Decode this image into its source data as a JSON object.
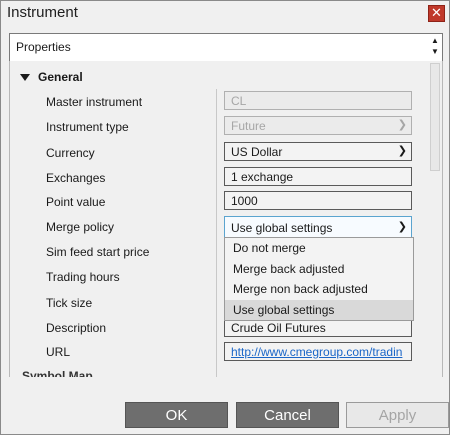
{
  "window": {
    "title": "Instrument",
    "close_glyph": "✕"
  },
  "header": {
    "label": "Properties"
  },
  "section": {
    "label": "General",
    "next_label": "Symbol Map"
  },
  "rows": [
    {
      "label": "Master instrument",
      "value": "CL"
    },
    {
      "label": "Instrument type",
      "value": "Future"
    },
    {
      "label": "Currency",
      "value": "US Dollar"
    },
    {
      "label": "Exchanges",
      "value": "1 exchange"
    },
    {
      "label": "Point value",
      "value": "1000"
    },
    {
      "label": "Merge policy",
      "value": "Use global settings"
    },
    {
      "label": "Sim feed start price"
    },
    {
      "label": "Trading hours"
    },
    {
      "label": "Tick size"
    },
    {
      "label": "Description",
      "value": "Crude Oil Futures"
    },
    {
      "label": "URL",
      "value": "http://www.cmegroup.com/tradin"
    }
  ],
  "merge_options": [
    "Do not merge",
    "Merge back adjusted",
    "Merge non back adjusted",
    "Use global settings"
  ],
  "buttons": {
    "ok": "OK",
    "cancel": "Cancel",
    "apply": "Apply"
  },
  "icons": {
    "close": "close-icon",
    "chevron": "chevron-down-icon",
    "collapse": "triangle-down-icon"
  },
  "colors": {
    "close_bg": "#c0392b",
    "button_dark": "#6e6e6e",
    "link": "#1a66c8",
    "focus_border": "#5ba4cf"
  }
}
